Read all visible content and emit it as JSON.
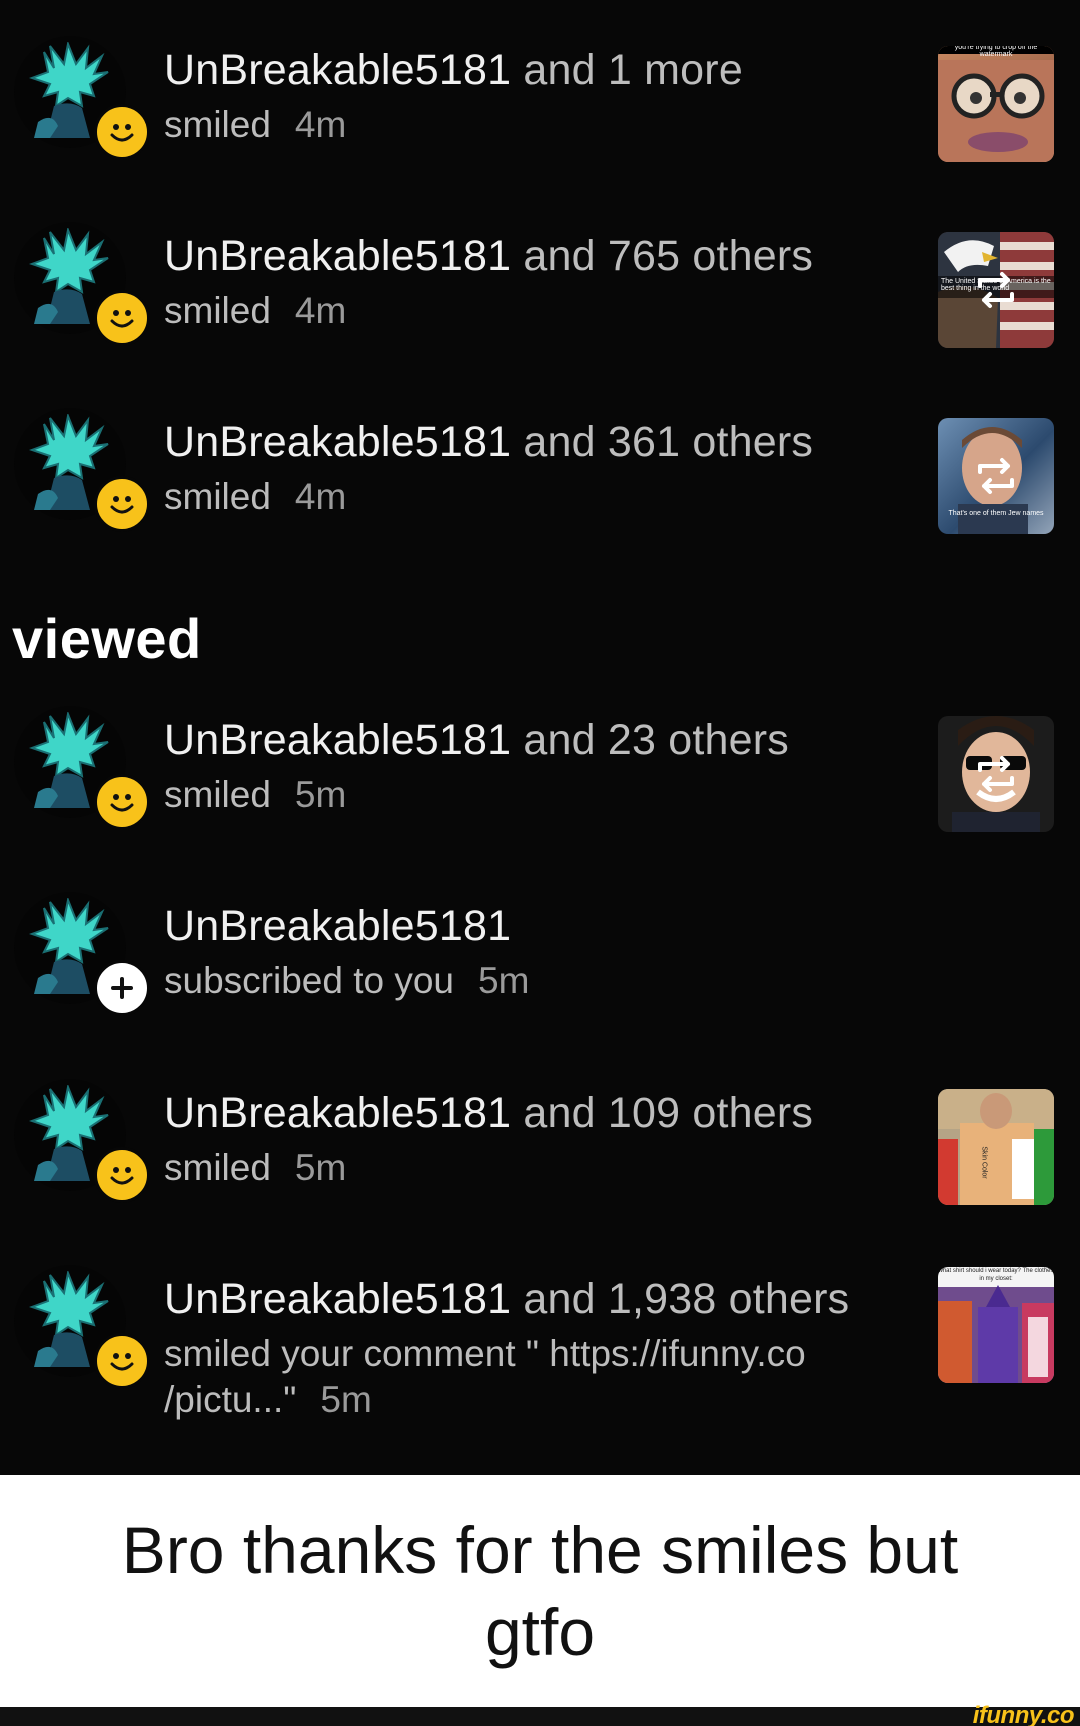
{
  "notifications_before": [
    {
      "user": "UnBreakable5181",
      "rest": " and 1 more",
      "action": "smiled",
      "time": "4m",
      "badge": "smile",
      "thumb": {
        "kind": "glasses",
        "caption": "you're trying to crop off the watermark",
        "repost": false
      }
    },
    {
      "user": "UnBreakable5181",
      "rest": " and 765 others",
      "action": "smiled",
      "time": "4m",
      "badge": "smile",
      "thumb": {
        "kind": "eagle",
        "caption": "The United States of America is the best thing in the world",
        "repost": true
      }
    },
    {
      "user": "UnBreakable5181",
      "rest": " and 361 others",
      "action": "smiled",
      "time": "4m",
      "badge": "smile",
      "thumb": {
        "kind": "man",
        "caption": "That's one of them Jew names",
        "repost": true
      }
    }
  ],
  "section_title": "viewed",
  "notifications_after": [
    {
      "user": "UnBreakable5181",
      "rest": " and 23 others",
      "action": "smiled",
      "time": "5m",
      "badge": "smile",
      "thumb": {
        "kind": "sunglasses",
        "caption": "",
        "repost": true
      }
    },
    {
      "user": "UnBreakable5181",
      "rest": "",
      "action": "subscribed to you",
      "time": "5m",
      "badge": "plus",
      "thumb": null
    },
    {
      "user": "UnBreakable5181",
      "rest": " and 109 others",
      "action": "smiled",
      "time": "5m",
      "badge": "smile",
      "thumb": {
        "kind": "crayon",
        "caption": "Skin Color",
        "repost": false
      }
    },
    {
      "user": "UnBreakable5181",
      "rest": " and 1,938 others",
      "action": "smiled your comment \" https://ifunny.co /pictu...\"",
      "time": "5m",
      "badge": "smile",
      "thumb": {
        "kind": "crayons",
        "caption": "what shirt should i wear today? The clothes in my closet:",
        "repost": false
      }
    }
  ],
  "caption": "Bro thanks for the smiles but gtfo",
  "watermark": "ifunny.co",
  "colors": {
    "badge_smile": "#f8c21a",
    "background": "#070707",
    "accent_avatar": "#3fd6c8"
  }
}
